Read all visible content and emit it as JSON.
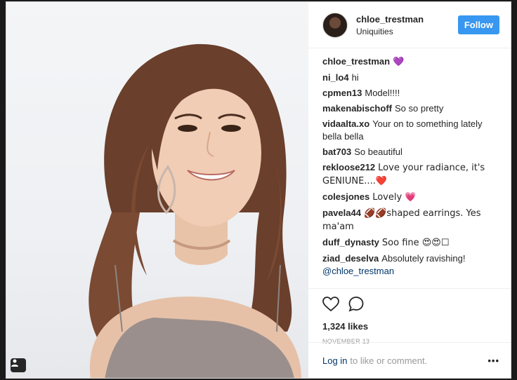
{
  "header": {
    "username": "chloe_trestman",
    "location": "Uniquities",
    "follow_label": "Follow"
  },
  "caption": {
    "username": "chloe_trestman",
    "text": "💜"
  },
  "comments": [
    {
      "user": "ni_lo4",
      "text": "hi"
    },
    {
      "user": "cpmen13",
      "text": "Model!!!!"
    },
    {
      "user": "makenabischoff",
      "text": "So so pretty"
    },
    {
      "user": "vidaalta.xo",
      "text": "Your on to something lately bella bella"
    },
    {
      "user": "bat703",
      "text": "So beautiful"
    },
    {
      "user": "rekloose212",
      "text": "Love your radiance, it's GENIUNE....❤️"
    },
    {
      "user": "colesjones",
      "text": "Lovely 💗"
    },
    {
      "user": "pavela44",
      "text": "🏈🏈shaped earrings. Yes ma'am"
    },
    {
      "user": "duff_dynasty",
      "text": "Soo fine 😍😍☐"
    },
    {
      "user": "ziad_deselva",
      "text": "Absolutely ravishing!",
      "mention": "@chloe_trestman"
    }
  ],
  "actions": {
    "like_icon": "heart-icon",
    "comment_icon": "comment-icon",
    "likes": "1,324 likes",
    "date": "NOVEMBER 13"
  },
  "footer": {
    "login_label": "Log in",
    "login_suffix": "to like or comment.",
    "more_label": "•••"
  },
  "colors": {
    "follow": "#3897f0",
    "link": "#003569",
    "text": "#262626",
    "muted": "#999999"
  }
}
